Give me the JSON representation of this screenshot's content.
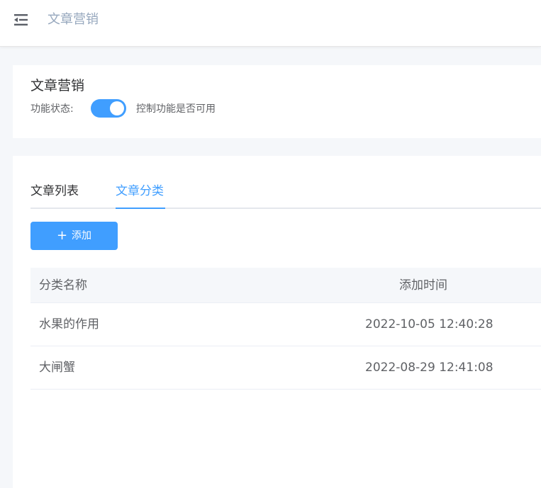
{
  "header": {
    "menu_icon": "menu-fold-icon",
    "breadcrumb": "文章营销"
  },
  "feature": {
    "title": "文章营销",
    "status_label": "功能状态:",
    "status_enabled": true,
    "status_desc": "控制功能是否可用",
    "accent_color": "#409eff"
  },
  "tabs": [
    {
      "label": "文章列表",
      "active": false
    },
    {
      "label": "文章分类",
      "active": true
    }
  ],
  "toolbar": {
    "add_icon": "plus-icon",
    "add_label": "添加"
  },
  "table": {
    "columns": [
      "分类名称",
      "添加时间"
    ],
    "rows": [
      {
        "name": "水果的作用",
        "time": "2022-10-05 12:40:28"
      },
      {
        "name": "大闸蟹",
        "time": "2022-08-29 12:41:08"
      }
    ]
  }
}
